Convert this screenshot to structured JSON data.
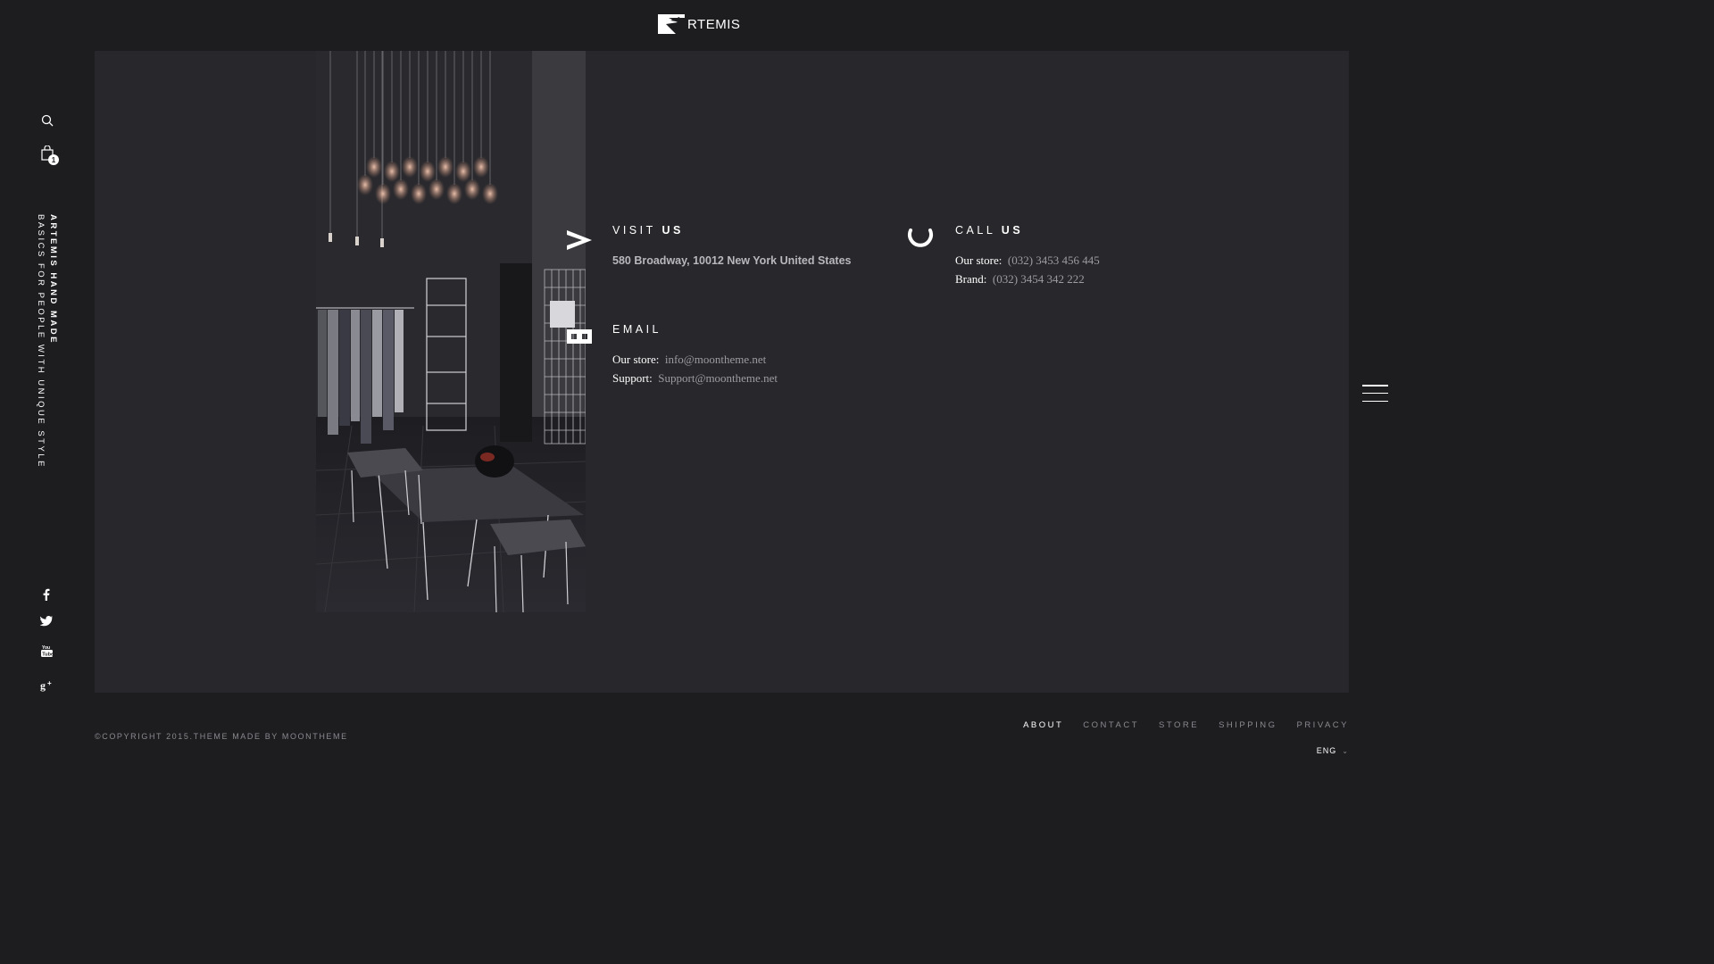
{
  "brand": {
    "logo_text": "RTEMIS"
  },
  "rail": {
    "search_icon": "search-icon",
    "cart_icon": "shopping-bag-icon",
    "cart_count": "1",
    "tagline_strong": "ARTEMIS HAND MADE",
    "tagline": "BASICS FOR PEOPLE WITH UNIQUE STYLE",
    "social": [
      {
        "name": "facebook-icon",
        "glyph": "f"
      },
      {
        "name": "twitter-icon",
        "glyph": "t"
      },
      {
        "name": "youtube-icon",
        "glyph": "▶"
      },
      {
        "name": "google-plus-icon",
        "glyph": "g+"
      }
    ]
  },
  "contact": {
    "visit": {
      "title_light": "VISIT",
      "title_bold": "US",
      "address": "580 Broadway, 10012 New York United States"
    },
    "call": {
      "title_light": "CALL",
      "title_bold": "US",
      "store_label": "Our store:",
      "store_value": "(032) 3453 456 445",
      "brand_label": "Brand:",
      "brand_value": "(032) 3454 342 222"
    },
    "email": {
      "title": "EMAIL",
      "store_label": "Our store:",
      "store_value": "info@moontheme.net",
      "support_label": "Support:",
      "support_value": "Support@moontheme.net"
    }
  },
  "footer": {
    "copyright": "©COPYRIGHT 2015.THEME MADE BY MOONTHEME",
    "nav": [
      "ABOUT",
      "CONTACT",
      "STORE",
      "SHIPPING",
      "PRIVACY"
    ],
    "language": "ENG"
  }
}
